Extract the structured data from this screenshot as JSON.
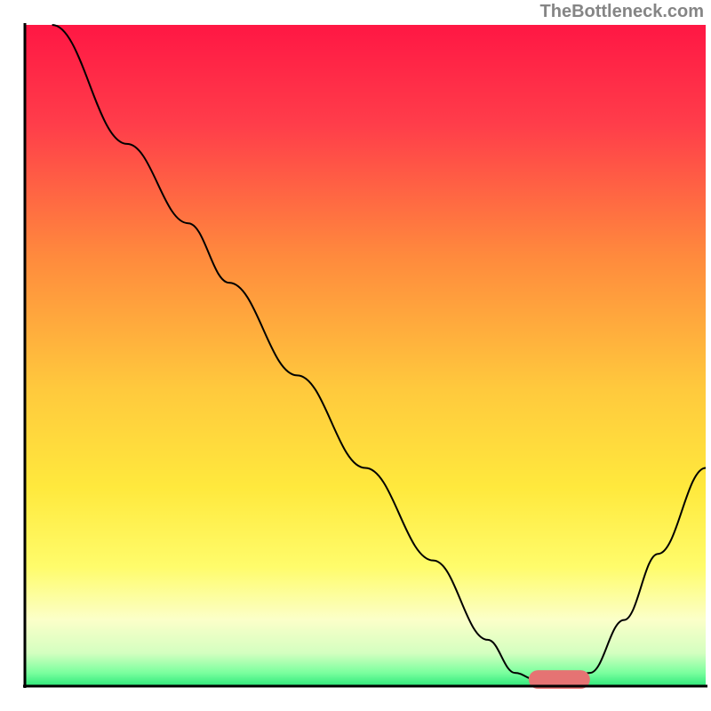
{
  "watermark": "TheBottleneck.com",
  "chart_data": {
    "type": "line",
    "title": "",
    "xlabel": "",
    "ylabel": "",
    "xlim": [
      0,
      100
    ],
    "ylim": [
      0,
      100
    ],
    "background": {
      "type": "vertical_gradient",
      "stops": [
        {
          "offset": 0,
          "color": "#ff1744"
        },
        {
          "offset": 15,
          "color": "#ff3d4a"
        },
        {
          "offset": 35,
          "color": "#ff8a3d"
        },
        {
          "offset": 55,
          "color": "#ffc93d"
        },
        {
          "offset": 70,
          "color": "#ffe93d"
        },
        {
          "offset": 82,
          "color": "#fffc6b"
        },
        {
          "offset": 90,
          "color": "#fbffc9"
        },
        {
          "offset": 95,
          "color": "#d4ffc0"
        },
        {
          "offset": 98,
          "color": "#7aff9e"
        },
        {
          "offset": 100,
          "color": "#2ee87a"
        }
      ]
    },
    "series": [
      {
        "name": "bottleneck-curve",
        "type": "line",
        "color": "#000000",
        "width": 2,
        "points": [
          {
            "x": 4,
            "y": 100
          },
          {
            "x": 15,
            "y": 82
          },
          {
            "x": 24,
            "y": 70
          },
          {
            "x": 30,
            "y": 61
          },
          {
            "x": 40,
            "y": 47
          },
          {
            "x": 50,
            "y": 33
          },
          {
            "x": 60,
            "y": 19
          },
          {
            "x": 68,
            "y": 7
          },
          {
            "x": 72,
            "y": 2
          },
          {
            "x": 75,
            "y": 1
          },
          {
            "x": 80,
            "y": 1
          },
          {
            "x": 83,
            "y": 2
          },
          {
            "x": 88,
            "y": 10
          },
          {
            "x": 93,
            "y": 20
          },
          {
            "x": 100,
            "y": 33
          }
        ]
      }
    ],
    "marker": {
      "name": "optimal-range",
      "shape": "capsule",
      "color": "#e57373",
      "x_start": 74,
      "x_end": 83,
      "y": 0,
      "height": 2
    },
    "axes": {
      "color": "#000000",
      "width": 3
    }
  }
}
